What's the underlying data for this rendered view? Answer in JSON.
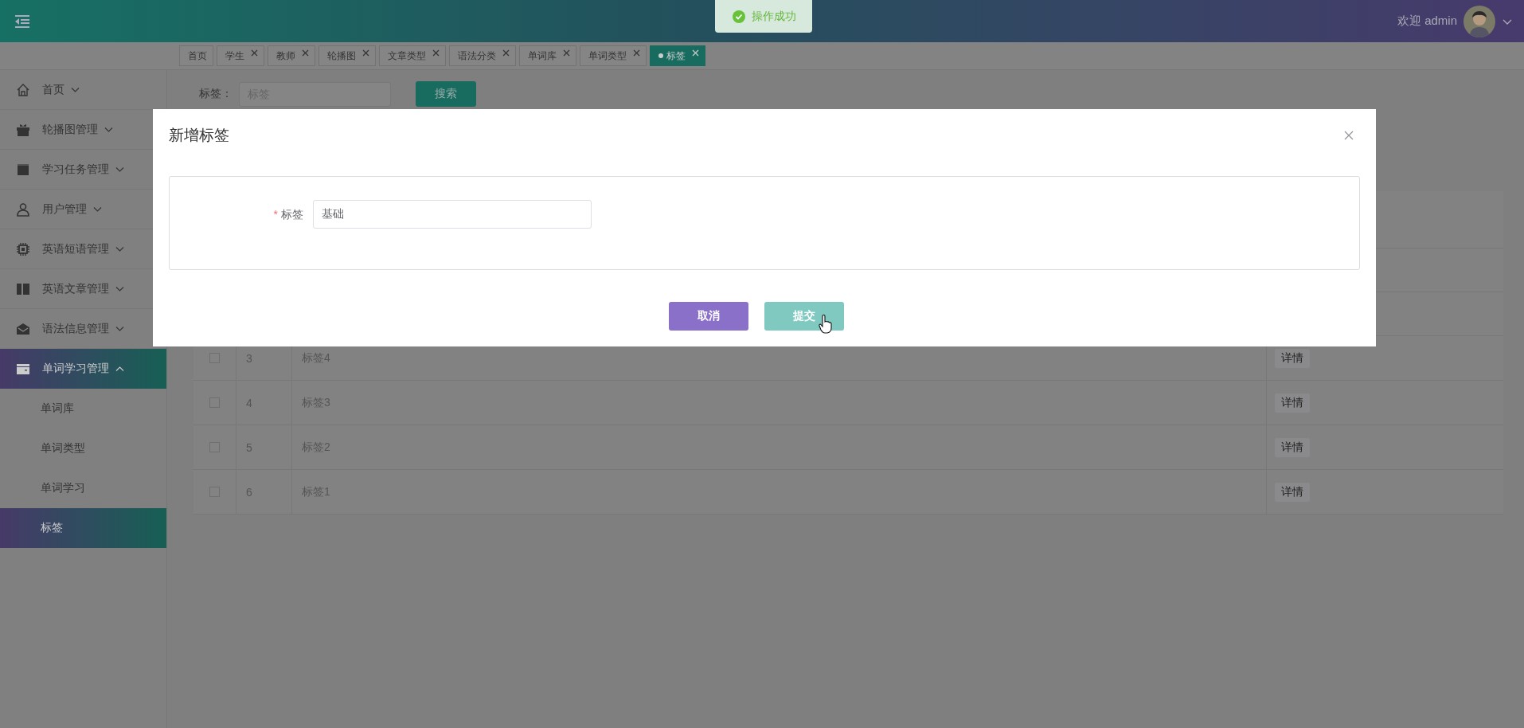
{
  "header": {
    "welcome": "欢迎 admin"
  },
  "toast": {
    "message": "操作成功"
  },
  "tabs": [
    {
      "label": "首页",
      "closable": false,
      "selected": false
    },
    {
      "label": "学生",
      "closable": true,
      "selected": false
    },
    {
      "label": "教师",
      "closable": true,
      "selected": false
    },
    {
      "label": "轮播图",
      "closable": true,
      "selected": false
    },
    {
      "label": "文章类型",
      "closable": true,
      "selected": false
    },
    {
      "label": "语法分类",
      "closable": true,
      "selected": false
    },
    {
      "label": "单词库",
      "closable": true,
      "selected": false
    },
    {
      "label": "单词类型",
      "closable": true,
      "selected": false
    },
    {
      "label": "标签",
      "closable": true,
      "selected": true
    }
  ],
  "sidebar": {
    "items": [
      {
        "label": "首页",
        "expanded": false,
        "selected": false
      },
      {
        "label": "轮播图管理",
        "expanded": false,
        "selected": false
      },
      {
        "label": "学习任务管理",
        "expanded": false,
        "selected": false
      },
      {
        "label": "用户管理",
        "expanded": false,
        "selected": false
      },
      {
        "label": "英语短语管理",
        "expanded": false,
        "selected": false
      },
      {
        "label": "英语文章管理",
        "expanded": false,
        "selected": false
      },
      {
        "label": "语法信息管理",
        "expanded": false,
        "selected": false
      },
      {
        "label": "单词学习管理",
        "expanded": true,
        "selected": true,
        "children": [
          {
            "label": "单词库",
            "selected": false
          },
          {
            "label": "单词类型",
            "selected": false
          },
          {
            "label": "单词学习",
            "selected": false
          },
          {
            "label": "标签",
            "selected": true
          }
        ]
      }
    ]
  },
  "search": {
    "label": "标签：",
    "placeholder": "标签",
    "button": "搜索"
  },
  "table": {
    "rows": [
      {
        "checked": false,
        "id": "3",
        "name": "标签4",
        "action": "详情"
      },
      {
        "checked": false,
        "id": "4",
        "name": "标签3",
        "action": "详情"
      },
      {
        "checked": false,
        "id": "5",
        "name": "标签2",
        "action": "详情"
      },
      {
        "checked": false,
        "id": "6",
        "name": "标签1",
        "action": "详情"
      }
    ]
  },
  "dialog": {
    "title": "新增标签",
    "field": {
      "label": "标签",
      "required_mark": "*",
      "value": "基础"
    },
    "buttons": [
      {
        "label": "取消",
        "kind": "cancel"
      },
      {
        "label": "提交",
        "kind": "submit"
      }
    ]
  }
}
